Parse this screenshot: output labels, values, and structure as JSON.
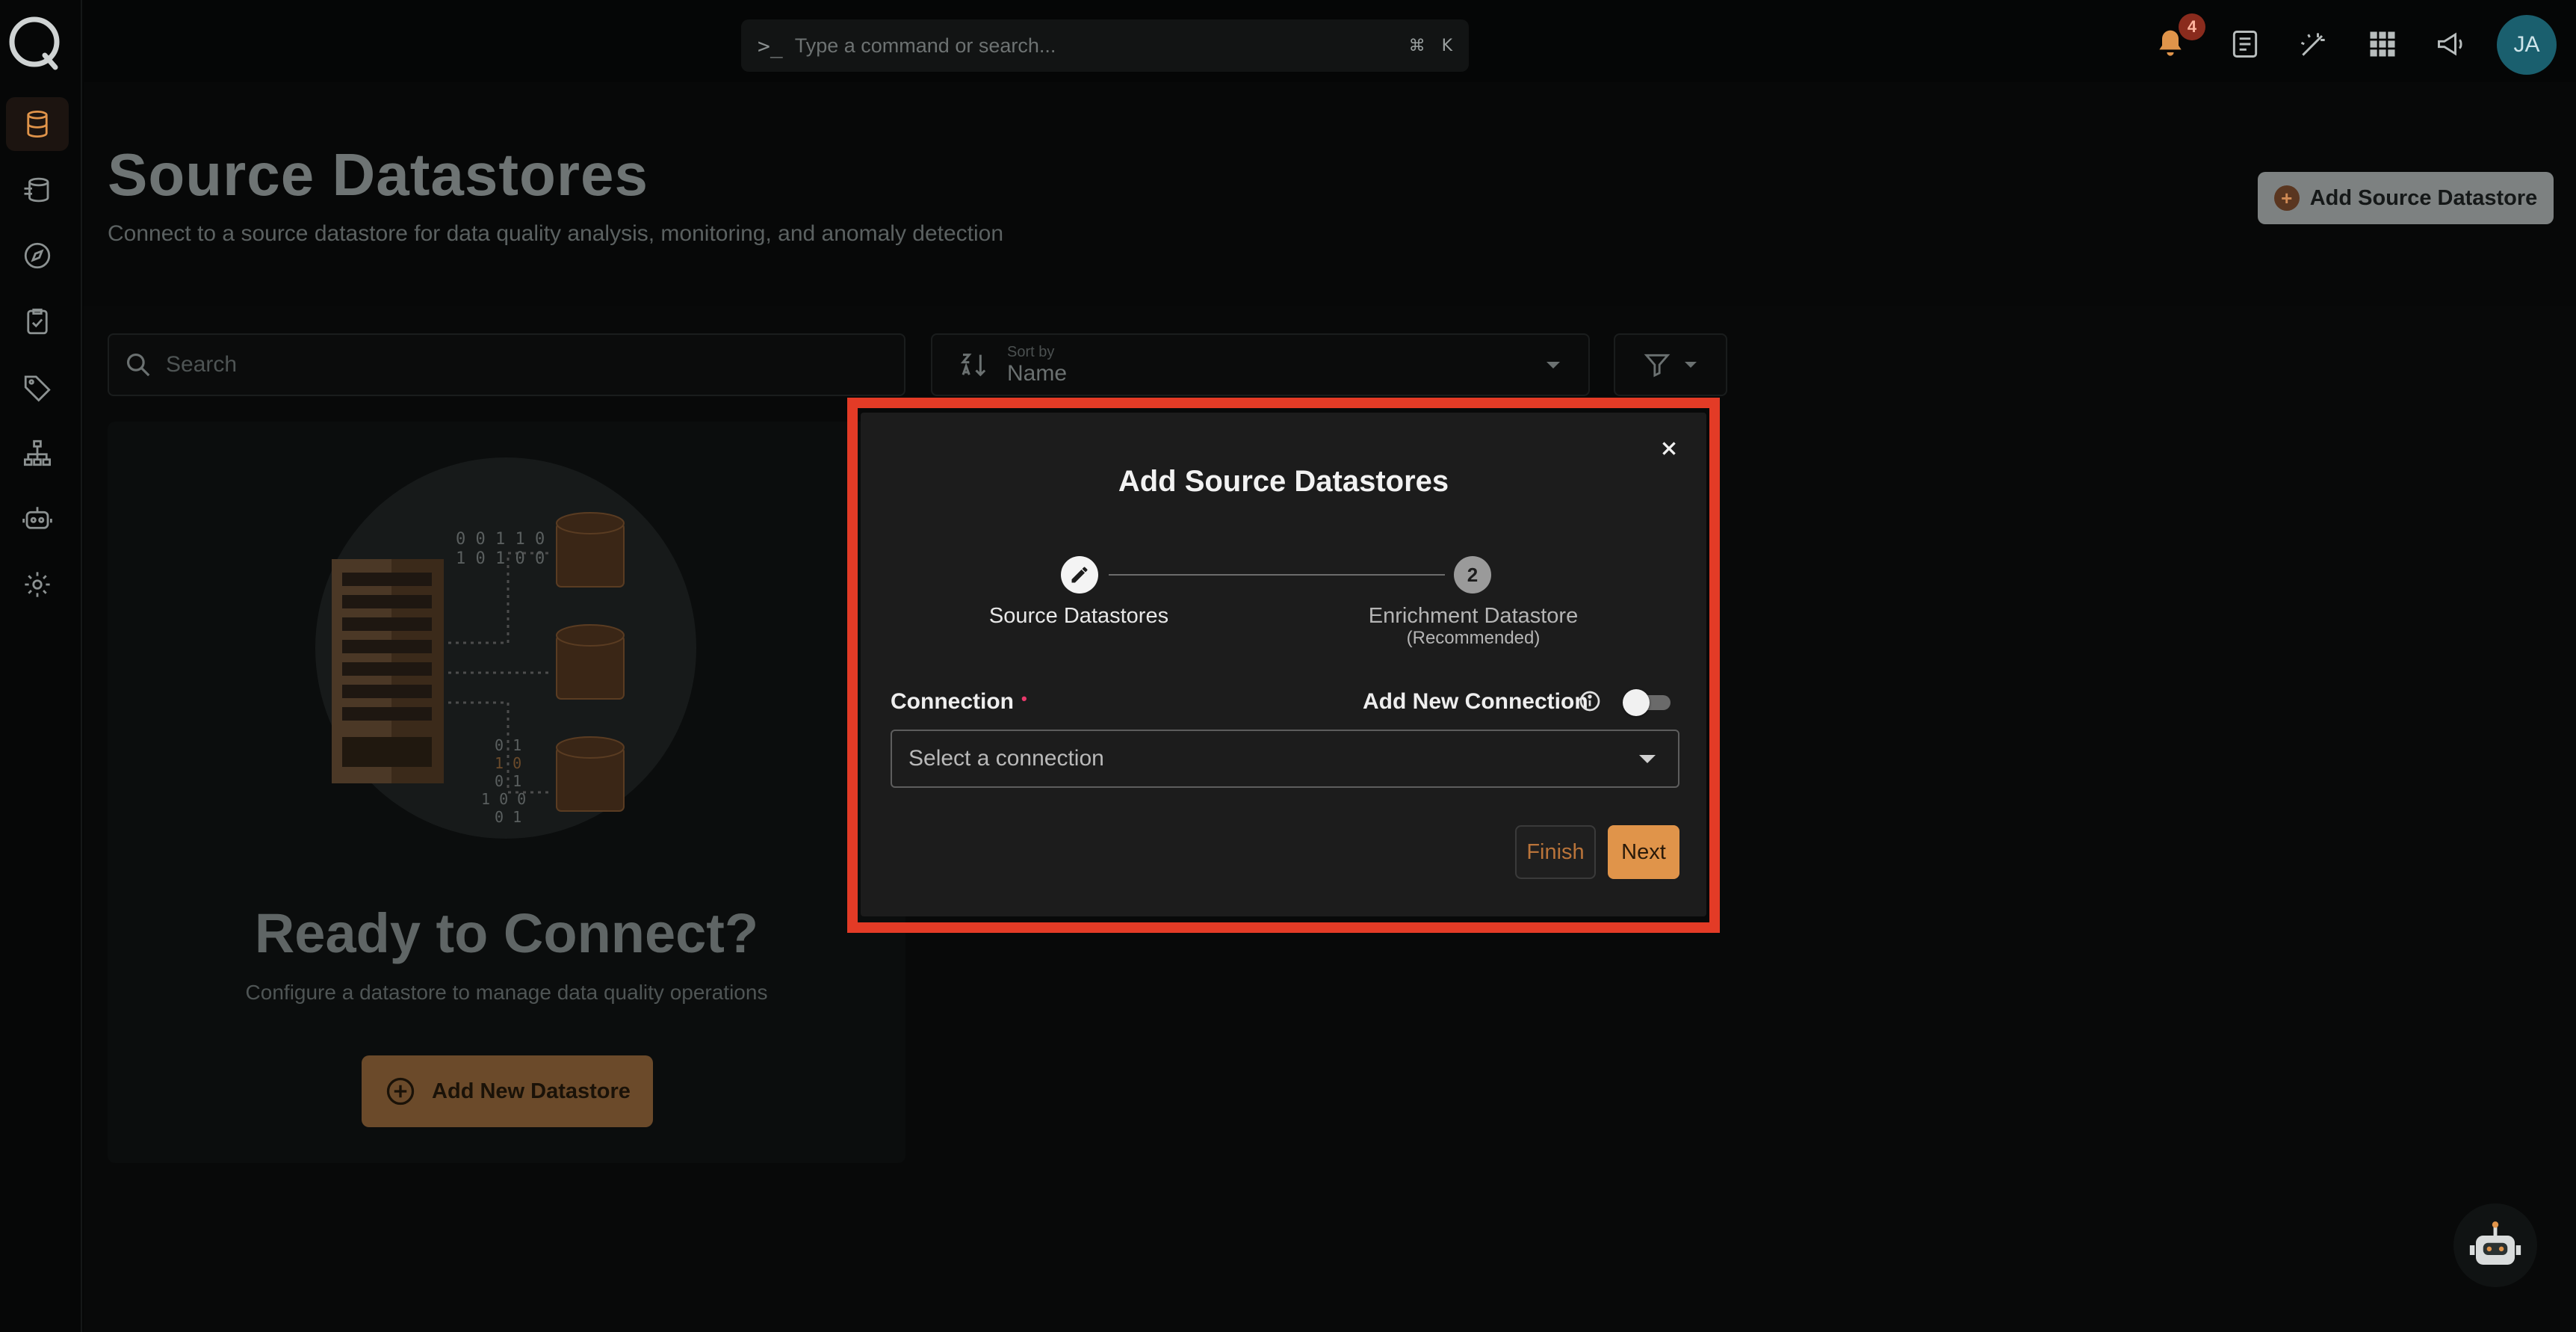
{
  "topbar": {
    "command_prompt_symbol": ">_",
    "command_placeholder": "Type a command or search...",
    "shortcut_cmd": "⌘",
    "shortcut_key": "K",
    "notification_count": "4",
    "user_initials": "JA"
  },
  "sidebar": {
    "items": [
      {
        "name": "datastores",
        "active": true
      },
      {
        "name": "enrichment"
      },
      {
        "name": "explore"
      },
      {
        "name": "checks"
      },
      {
        "name": "tags"
      },
      {
        "name": "flows"
      },
      {
        "name": "agents"
      },
      {
        "name": "settings"
      }
    ]
  },
  "page": {
    "title": "Source Datastores",
    "subtitle": "Connect to a source datastore for data quality analysis, monitoring, and anomaly detection",
    "add_button_label": "Add Source Datastore"
  },
  "toolbar": {
    "search_placeholder": "Search",
    "sort_caption": "Sort by",
    "sort_value": "Name"
  },
  "empty_state": {
    "title": "Ready to Connect?",
    "subtitle": "Configure a datastore to manage data quality operations",
    "button_label": "Add New Datastore",
    "binary_top": [
      "0 0 1 1 0",
      "1 0 1 0 0"
    ],
    "binary_bottom": [
      "0 1",
      "1 0",
      "0 1",
      "1 0 0",
      "0 1"
    ]
  },
  "modal": {
    "title": "Add Source Datastores",
    "steps": [
      {
        "number": "1",
        "label": "Source Datastores",
        "state": "active"
      },
      {
        "number": "2",
        "label": "Enrichment Datastore",
        "sublabel": "(Recommended)",
        "state": "pending"
      }
    ],
    "connection_label": "Connection",
    "required_marker": "•",
    "add_new_connection_label": "Add New Connection",
    "add_new_connection_enabled": false,
    "connection_select_placeholder": "Select a connection",
    "finish_label": "Finish",
    "next_label": "Next"
  },
  "colors": {
    "accent": "#e0944a",
    "highlight_border": "#e33b26",
    "modal_bg": "#1c1c1c",
    "required": "#e8396b"
  }
}
